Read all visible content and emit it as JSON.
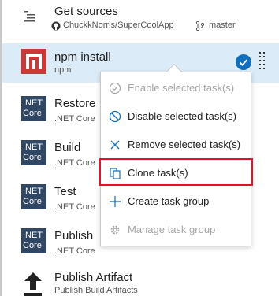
{
  "sources": {
    "title": "Get sources",
    "repo": "ChuckkNorris/SuperCoolApp",
    "branch": "master"
  },
  "tasks": [
    {
      "name": "npm install",
      "sub": "npm",
      "icon": "npm-icon"
    },
    {
      "name": "Restore",
      "sub": ".NET Core",
      "icon": "dotnet-core-icon"
    },
    {
      "name": "Build",
      "sub": ".NET Core",
      "icon": "dotnet-core-icon"
    },
    {
      "name": "Test",
      "sub": ".NET Core",
      "icon": "dotnet-core-icon"
    },
    {
      "name": "Publish",
      "sub": ".NET Core",
      "icon": "dotnet-core-icon"
    },
    {
      "name": "Publish Artifact",
      "sub": "Publish Build Artifacts",
      "icon": "upload-arrow-icon"
    }
  ],
  "net_icon": {
    "line1": ".NET",
    "line2": "Core"
  },
  "context_menu": {
    "items": [
      {
        "label": "Enable selected task(s)",
        "icon": "check-circle-icon",
        "enabled": false
      },
      {
        "label": "Disable selected task(s)",
        "icon": "blocked-circle-icon",
        "enabled": true
      },
      {
        "label": "Remove selected task(s)",
        "icon": "close-icon",
        "enabled": true
      },
      {
        "label": "Clone task(s)",
        "icon": "copy-icon",
        "enabled": true
      },
      {
        "label": "Create task group",
        "icon": "plus-icon",
        "enabled": true
      },
      {
        "label": "Manage task group",
        "icon": "gear-icon",
        "enabled": false
      }
    ]
  },
  "colors": {
    "accent": "#106ebe",
    "selected_row": "#dcebf8",
    "highlight": "#e81123",
    "dotnet": "#2f4762",
    "npm": "#cb3837"
  }
}
